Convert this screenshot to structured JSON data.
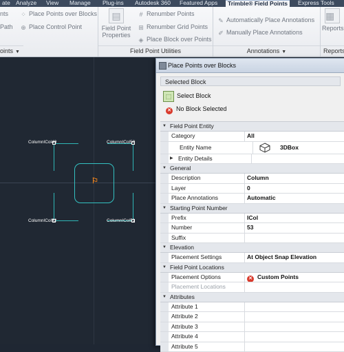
{
  "ribbon": {
    "tabs": [
      "ate",
      "Analyze",
      "View",
      "Manage",
      "Plug-ins",
      "Autodesk 360",
      "Featured Apps",
      "Trimble® Field Points",
      "Express Tools"
    ],
    "active_tab_index": 7,
    "col1": [
      "nts",
      "Path",
      "oints"
    ],
    "col2": [
      "Place Points over Blocks",
      "Place Control Point"
    ],
    "big_button": "Field Point Properties",
    "col3": [
      "Renumber Points",
      "Renumber Grid Points",
      "Place Block over Points"
    ],
    "group_field_utils": "Field Point Utilities",
    "col4": [
      "Automatically Place  Annotations",
      "Manually Place Annotations"
    ],
    "group_annotations": "Annotations",
    "reports_label": "Reports",
    "group_reports": "Reports"
  },
  "drawing": {
    "labels": [
      "ColumnICol49",
      "ColumnICol50",
      "ColumnICol52",
      "ColumnICol51"
    ]
  },
  "dialog": {
    "title": "Place Points over Blocks",
    "selected_block_header": "Selected Block",
    "select_block_button": "Select Block",
    "no_block_text": "No Block Selected",
    "sections": [
      {
        "name": "Field Point Entity",
        "rows": [
          {
            "key": "Category",
            "value": "All"
          },
          {
            "key": "Entity Name",
            "value": "3DBox",
            "icon": "cube-icon"
          },
          {
            "key": "Entity Details",
            "value": "",
            "expandable": true
          }
        ]
      },
      {
        "name": "General",
        "rows": [
          {
            "key": "Description",
            "value": "Column"
          },
          {
            "key": "Layer",
            "value": "0"
          },
          {
            "key": "Place Annotations",
            "value": "Automatic"
          }
        ]
      },
      {
        "name": "Starting Point Number",
        "rows": [
          {
            "key": "Prefix",
            "value": "ICol"
          },
          {
            "key": "Number",
            "value": "53"
          },
          {
            "key": "Suffix",
            "value": ""
          }
        ]
      },
      {
        "name": "Elevation",
        "rows": [
          {
            "key": "Placement Settings",
            "value": "At Object Snap Elevation"
          }
        ]
      },
      {
        "name": "Field Point Locations",
        "rows": [
          {
            "key": "Placement Options",
            "value": "Custom Points",
            "icon": "error-icon"
          },
          {
            "key": "Placement Locations",
            "value": "",
            "disabled": true
          }
        ]
      },
      {
        "name": "Attributes",
        "rows": [
          {
            "key": "Attribute 1",
            "value": ""
          },
          {
            "key": "Attribute 2",
            "value": ""
          },
          {
            "key": "Attribute 3",
            "value": ""
          },
          {
            "key": "Attribute 4",
            "value": ""
          },
          {
            "key": "Attribute 5",
            "value": ""
          }
        ]
      }
    ]
  },
  "colors": {
    "canvas": "#202833",
    "teal": "#2fb7b7",
    "accent_orange": "#ff8a1a",
    "error_red": "#d93a2c"
  }
}
